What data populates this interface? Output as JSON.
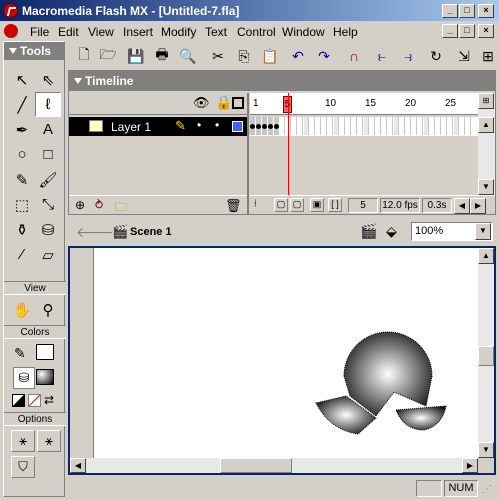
{
  "window": {
    "title": "Macromedia Flash MX - [Untitled-7.fla]",
    "min_glyph": "_",
    "max_glyph": "□",
    "close_glyph": "×"
  },
  "menu": {
    "items": [
      "File",
      "Edit",
      "View",
      "Insert",
      "Modify",
      "Text",
      "Control",
      "Window",
      "Help"
    ]
  },
  "tools": {
    "title": "Tools",
    "view_label": "View",
    "colors_label": "Colors",
    "options_label": "Options",
    "items": [
      {
        "name": "arrow-tool",
        "icon": "arrow-icon",
        "glyph": "↖"
      },
      {
        "name": "subselect-tool",
        "icon": "subselect-icon",
        "glyph": "⇖"
      },
      {
        "name": "line-tool",
        "icon": "line-icon",
        "glyph": "╱"
      },
      {
        "name": "lasso-tool",
        "icon": "lasso-icon",
        "glyph": "ℓ"
      },
      {
        "name": "pen-tool",
        "icon": "pen-icon",
        "glyph": "✒"
      },
      {
        "name": "text-tool",
        "icon": "text-icon",
        "glyph": "A"
      },
      {
        "name": "oval-tool",
        "icon": "oval-icon",
        "glyph": "○"
      },
      {
        "name": "rectangle-tool",
        "icon": "rectangle-icon",
        "glyph": "□"
      },
      {
        "name": "pencil-tool",
        "icon": "pencil-icon",
        "glyph": "✎"
      },
      {
        "name": "brush-tool",
        "icon": "brush-icon",
        "glyph": "🖌"
      },
      {
        "name": "free-transform-tool",
        "icon": "free-transform-icon",
        "glyph": "⬚"
      },
      {
        "name": "fill-transform-tool",
        "icon": "fill-transform-icon",
        "glyph": "⤡"
      },
      {
        "name": "ink-bottle-tool",
        "icon": "ink-bottle-icon",
        "glyph": "⚱"
      },
      {
        "name": "paint-bucket-tool",
        "icon": "paint-bucket-icon",
        "glyph": "⛁"
      },
      {
        "name": "eyedropper-tool",
        "icon": "eyedropper-icon",
        "glyph": "⁄"
      },
      {
        "name": "eraser-tool",
        "icon": "eraser-icon",
        "glyph": "▱"
      }
    ],
    "view_items": [
      {
        "name": "hand-tool",
        "icon": "hand-icon",
        "glyph": "✋"
      },
      {
        "name": "zoom-tool",
        "icon": "zoom-icon",
        "glyph": "⚲"
      }
    ]
  },
  "timeline": {
    "title": "Timeline",
    "layer_name": "Layer 1",
    "frame_numbers": [
      "1",
      "5",
      "10",
      "15",
      "20",
      "25"
    ],
    "current_frame": "5",
    "fps": "12.0 fps",
    "time": "0.3s",
    "keyframes": 5
  },
  "editbar": {
    "scene": "Scene 1",
    "zoom": "100%"
  },
  "status": {
    "num": "NUM"
  },
  "colors": {
    "titlebar_start": "#0a246a",
    "playhead": "#ff6060",
    "layer_color": "#4060ff"
  }
}
